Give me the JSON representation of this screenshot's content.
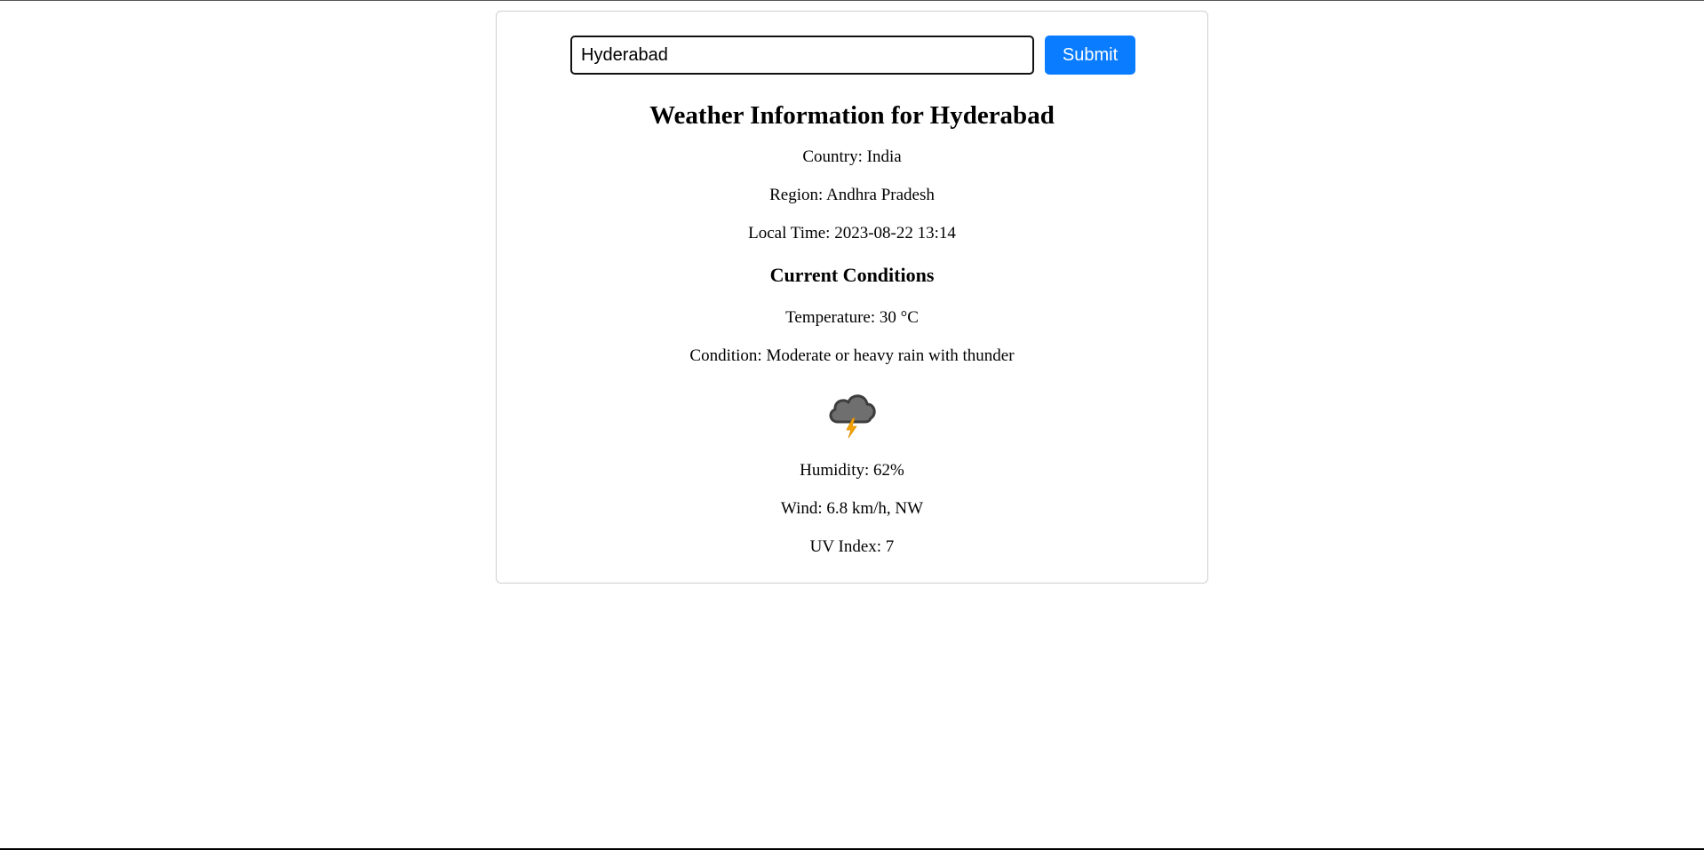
{
  "search": {
    "value": "Hyderabad ",
    "button_label": "Submit"
  },
  "weather": {
    "title": "Weather Information for Hyderabad",
    "country": "Country: India",
    "region": "Region: Andhra Pradesh",
    "local_time": "Local Time: 2023-08-22 13:14",
    "current_heading": "Current Conditions",
    "temperature": "Temperature: 30 °C",
    "condition": "Condition: Moderate or heavy rain with thunder",
    "condition_icon": "thunderstorm-cloud-icon",
    "humidity": "Humidity: 62%",
    "wind": "Wind: 6.8 km/h, NW",
    "uv_index": "UV Index: 7"
  },
  "colors": {
    "button": "#0a7cff",
    "cloud": "#6f6f6f",
    "lightning": "#f5a300"
  }
}
